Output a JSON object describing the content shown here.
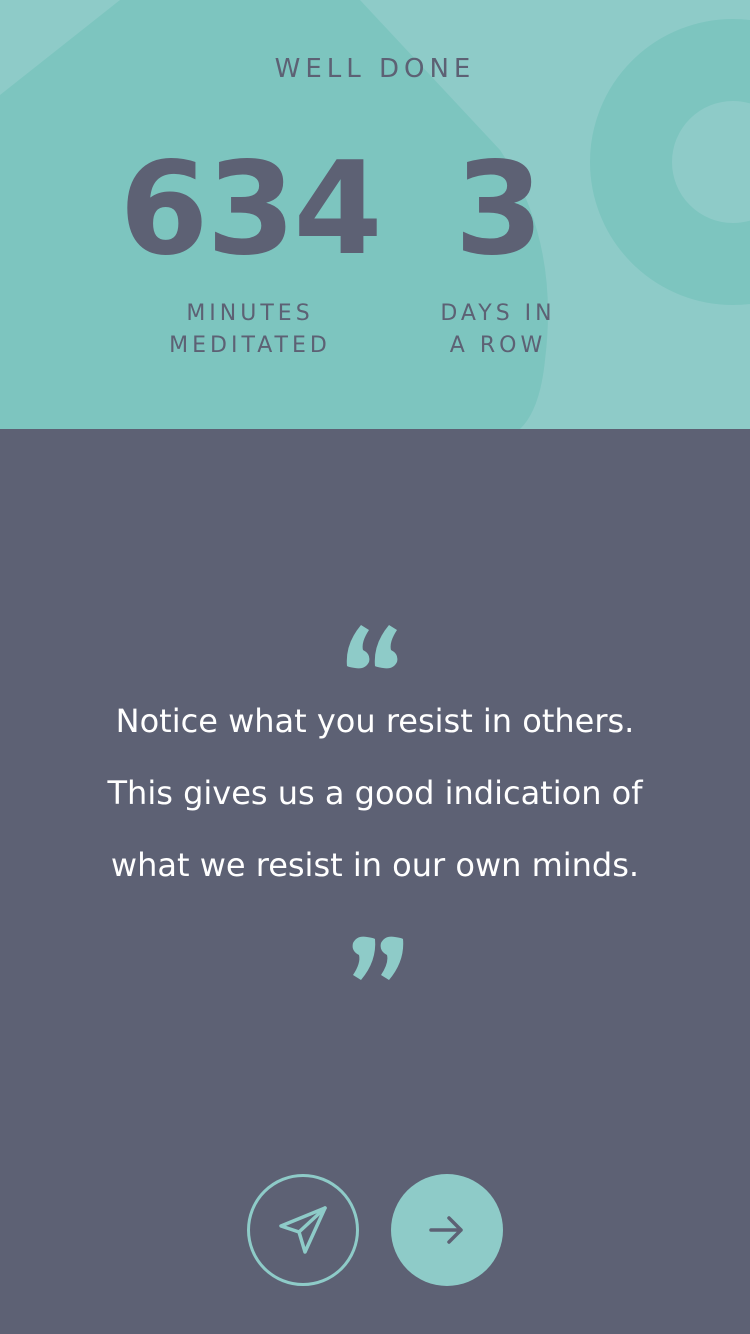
{
  "stats": {
    "headline": "WELL DONE",
    "minutes": {
      "value": "634",
      "label_line1": "MINUTES",
      "label_line2": "MEDITATED"
    },
    "days": {
      "value": "3",
      "label_line1": "DAYS IN",
      "label_line2": "A ROW"
    }
  },
  "quote": {
    "line1": "Notice what you resist in others.",
    "line2": "This gives us a good indication of",
    "line3": "what we resist in our own minds."
  },
  "actions": {
    "share_icon": "paper-plane-icon",
    "next_icon": "arrow-right-icon"
  },
  "colors": {
    "teal": "#8ecbc8",
    "teal_dark": "#7dc5bf",
    "slate": "#5d6174",
    "white": "#ffffff"
  }
}
